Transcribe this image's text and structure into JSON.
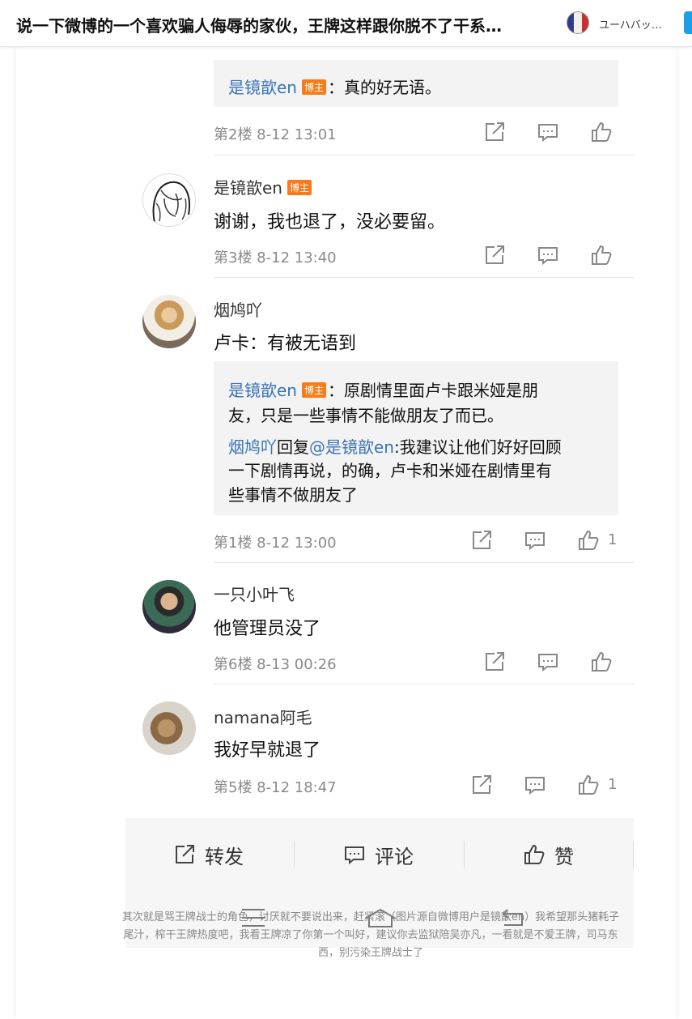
{
  "header": {
    "title": "说一下微博的一个喜欢骗人侮辱的家伙，王牌这样跟你脱不了干系…",
    "author": "ユーハバッ…"
  },
  "comments": [
    {
      "quote_user": "是镜歆en",
      "badge": "博主",
      "quote_text": "：真的好无语。",
      "meta": "第2楼  8-12 13:01"
    },
    {
      "username": "是镜歆en",
      "badge": "博主",
      "text": "谢谢，我也退了，没必要留。",
      "meta": "第3楼  8-12 13:40"
    },
    {
      "username": "烟鸠吖",
      "text": "卢卡：有被无语到",
      "reply1_user": "是镜歆en",
      "reply1_badge": "博主",
      "reply1_line1": "：原剧情里面卢卡跟米娅是朋",
      "reply1_line2": "友，只是一些事情不能做朋友了而已。",
      "reply2_user": "烟鸠吖",
      "reply2_mid": "回复",
      "reply2_at": "@是镜歆en",
      "reply2_line1": ":我建议让他们好好回顾",
      "reply2_line2": "一下剧情再说，的确，卢卡和米娅在剧情里有",
      "reply2_line3": "些事情不做朋友了",
      "meta": "第1楼  8-12 13:00",
      "likes": "1"
    },
    {
      "username": "一只小叶飞",
      "text": "他管理员没了",
      "meta": "第6楼  8-13 00:26"
    },
    {
      "username": "namana阿毛",
      "text": "我好早就退了",
      "meta": "第5楼  8-12 18:47",
      "likes": "1"
    }
  ],
  "actions": {
    "repost": "转发",
    "comment": "评论",
    "like": "赞"
  },
  "caption": "其次就是骂王牌战士的角色，讨厌就不要说出来，赶紧滚（图片源自微博用户是镜歆en）我希望那头猪耗子尾汁，榨干王牌热度吧，我看王牌凉了你第一个叫好，建议你去监狱陪吴亦凡，一看就是不爱王牌，司马东西，别污染王牌战士了",
  "colors": {
    "link": "#3a73b7",
    "badge": "#f77b1a",
    "meta": "#8a8a8a"
  }
}
